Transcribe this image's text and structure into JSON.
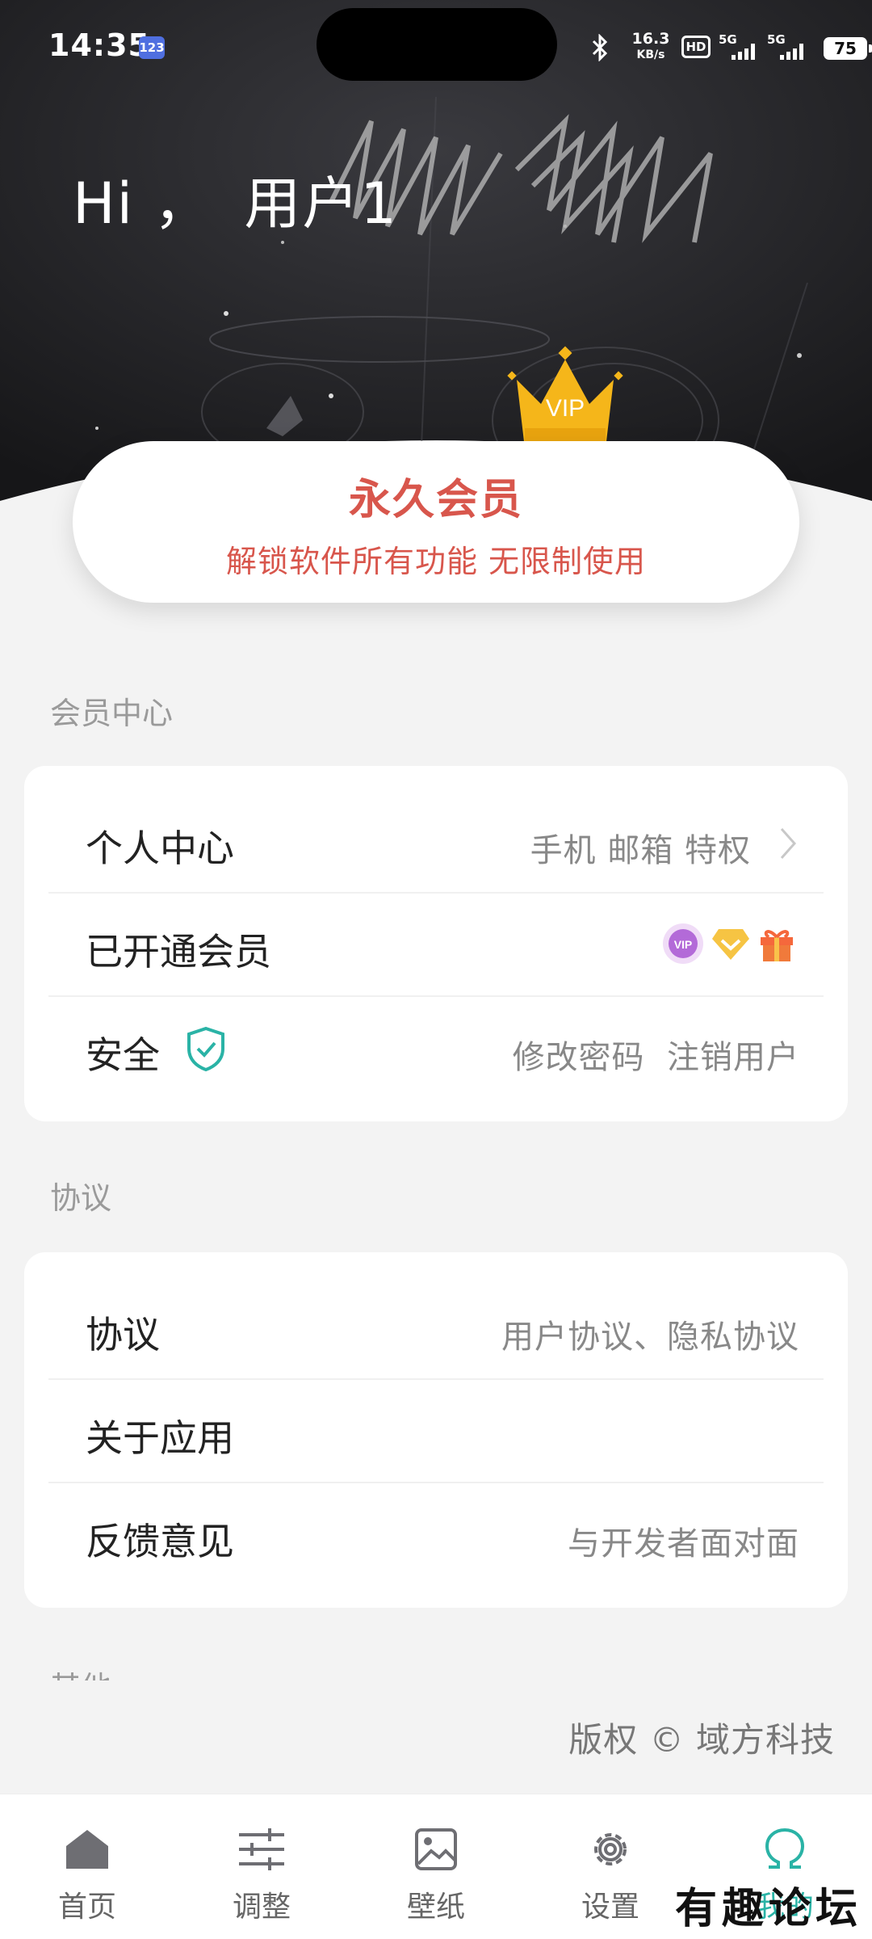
{
  "status_bar": {
    "time": "14:35",
    "app_badge": "123",
    "speed_value": "16.3",
    "speed_unit": "KB/s",
    "hd_label": "HD",
    "signal1_label": "5G",
    "signal2_label": "5G",
    "battery": "75"
  },
  "header": {
    "hi": "Hi ，",
    "username": "用户1"
  },
  "member_card": {
    "crown_text": "VIP",
    "title": "永久会员",
    "subtitle": "解锁软件所有功能 无限制使用"
  },
  "member_center": {
    "section_label": "会员中心",
    "rows": [
      {
        "title": "个人中心",
        "value": "手机 邮箱 特权"
      },
      {
        "title": "已开通会员",
        "badges": [
          "vip-badge-icon",
          "diamond-icon",
          "gift-icon"
        ]
      },
      {
        "title": "安全",
        "value": "修改密码  注销用户"
      }
    ]
  },
  "agreement": {
    "section_label": "协议",
    "rows": [
      {
        "title": "协议",
        "value": "用户协议、隐私协议"
      },
      {
        "title": "关于应用",
        "value": ""
      },
      {
        "title": "反馈意见",
        "value": "与开发者面对面"
      }
    ]
  },
  "other": {
    "section_label": "其他"
  },
  "copyright": "版权 © 域方科技",
  "nav": {
    "items": [
      {
        "label": "首页",
        "icon": "home-icon"
      },
      {
        "label": "调整",
        "icon": "sliders-icon"
      },
      {
        "label": "壁纸",
        "icon": "image-icon"
      },
      {
        "label": "设置",
        "icon": "gear-icon"
      },
      {
        "label": "我的",
        "icon": "profile-omega-icon"
      }
    ],
    "active": "我的"
  },
  "watermark": "有趣论坛",
  "colors": {
    "accent": "#2ab3a6",
    "member_red": "#d8564c",
    "header_bg": "#1f1f22",
    "page_bg": "#f3f3f3"
  }
}
